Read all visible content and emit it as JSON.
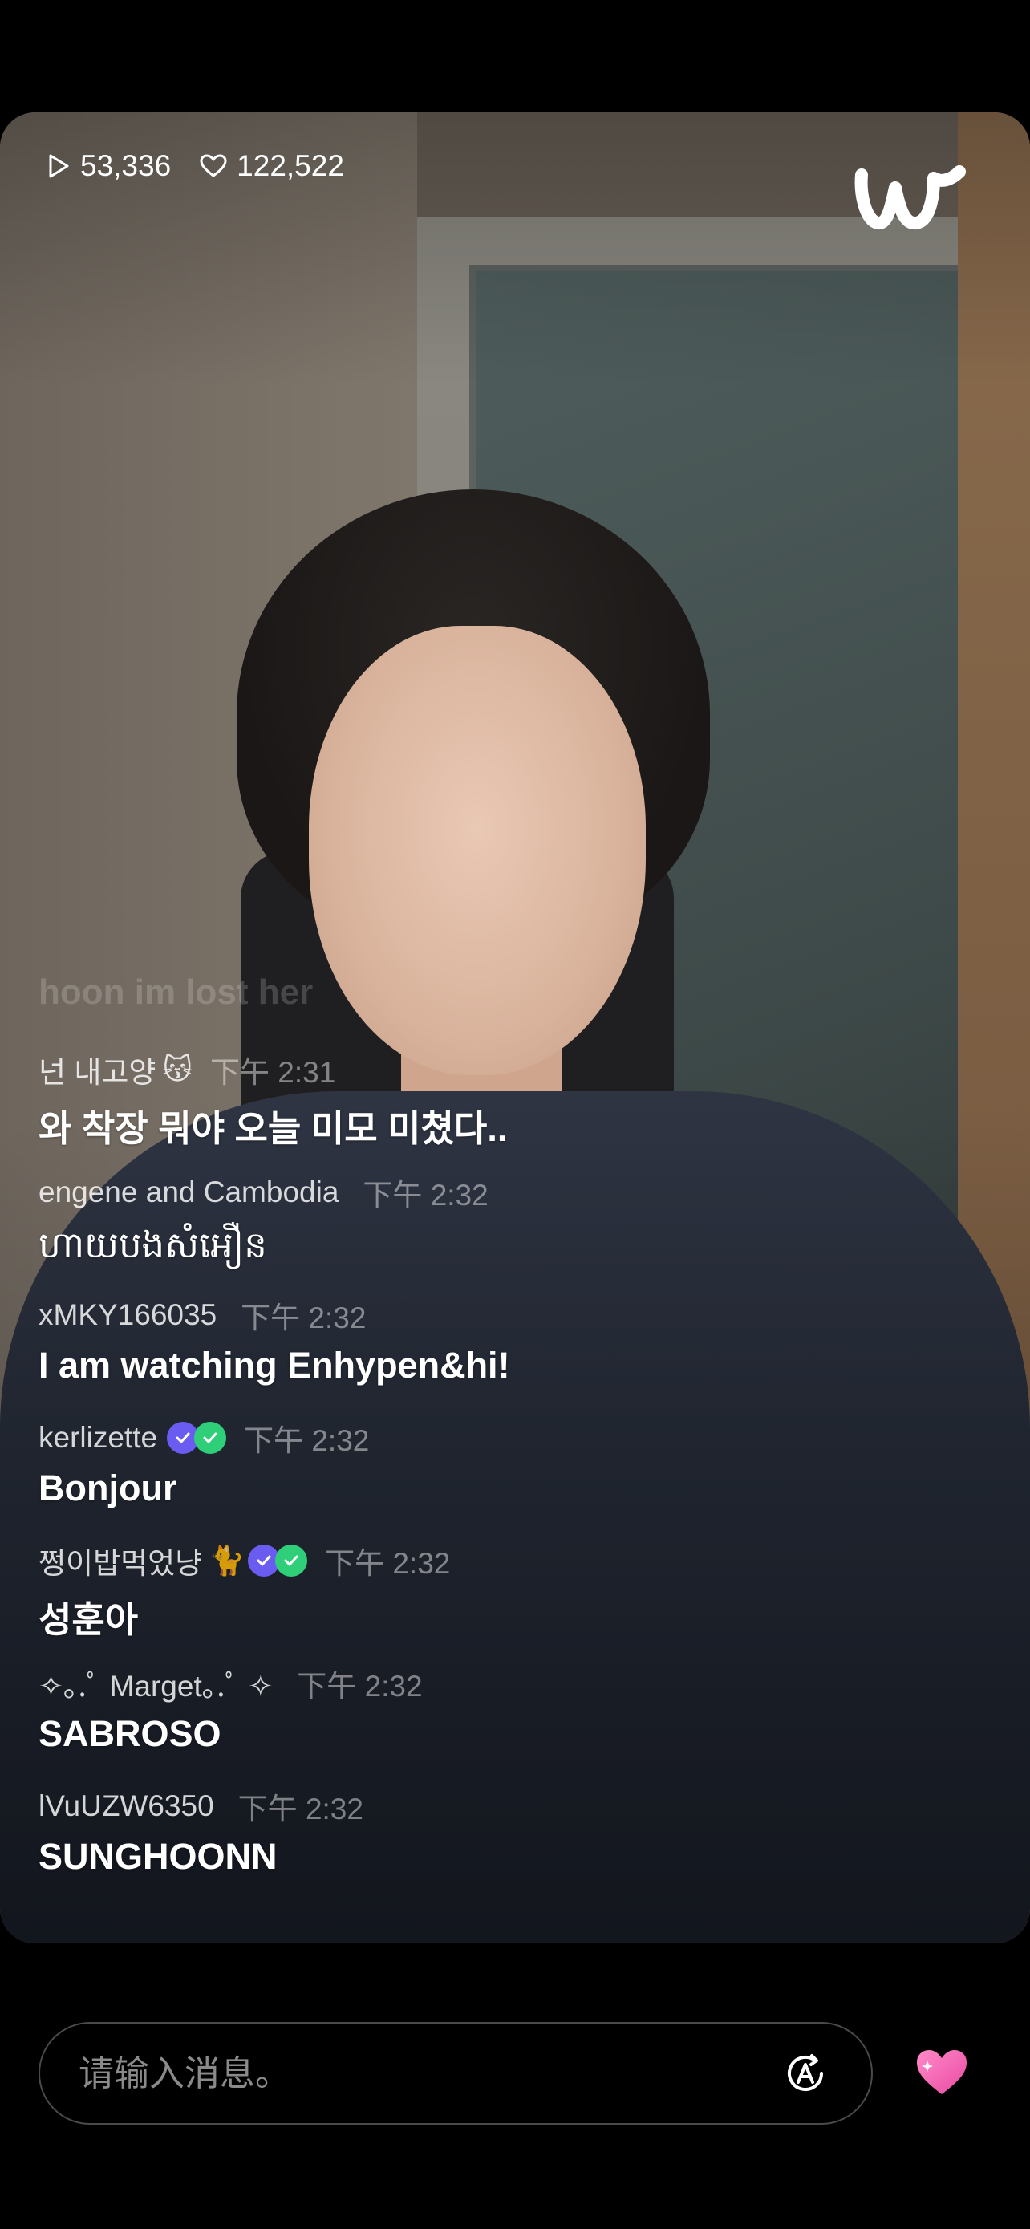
{
  "stats": {
    "plays": "53,336",
    "likes": "122,522"
  },
  "faded_message": "hoon im lost her",
  "messages": [
    {
      "user": "넌 내고양",
      "emoji": "😽",
      "badges": [],
      "time": "下午 2:31",
      "text": "와 착장 뭐야 오늘 미모 미쳤다..",
      "bold": true
    },
    {
      "user": "engene and Cambodia",
      "emoji": "",
      "badges": [],
      "time": "下午 2:32",
      "text": "ហាយបងសំអឿន",
      "bold": false
    },
    {
      "user": "xMKY166035",
      "emoji": "",
      "badges": [],
      "time": "下午 2:32",
      "text": "I am watching Enhypen&hi!",
      "bold": true
    },
    {
      "user": "kerlizette",
      "emoji": "",
      "badges": [
        "blue",
        "green"
      ],
      "time": "下午 2:32",
      "text": "Bonjour",
      "bold": true
    },
    {
      "user": "쩡이밥먹었냥",
      "emoji": "🐈",
      "badges": [
        "blue",
        "green"
      ],
      "time": "下午 2:32",
      "text": "성훈아",
      "bold": true
    },
    {
      "user": "✧｡.ﾟ Marget｡.ﾟ ✧",
      "emoji": "",
      "badges": [],
      "time": "下午 2:32",
      "text": "SABROSO",
      "bold": true
    },
    {
      "user": "lVuUZW6350",
      "emoji": "",
      "badges": [],
      "time": "下午 2:32",
      "text": "SUNGHOONN",
      "bold": true
    }
  ],
  "input": {
    "placeholder": "请输入消息。"
  },
  "icons": {
    "play": "play-icon",
    "like": "heart-outline-icon",
    "logo": "weverse-logo",
    "translate": "translate-icon",
    "heart": "heart-icon"
  },
  "colors": {
    "accent_heart": "#f06ab0",
    "badge_blue": "#6a5cf0",
    "badge_green": "#2fcf7a"
  }
}
